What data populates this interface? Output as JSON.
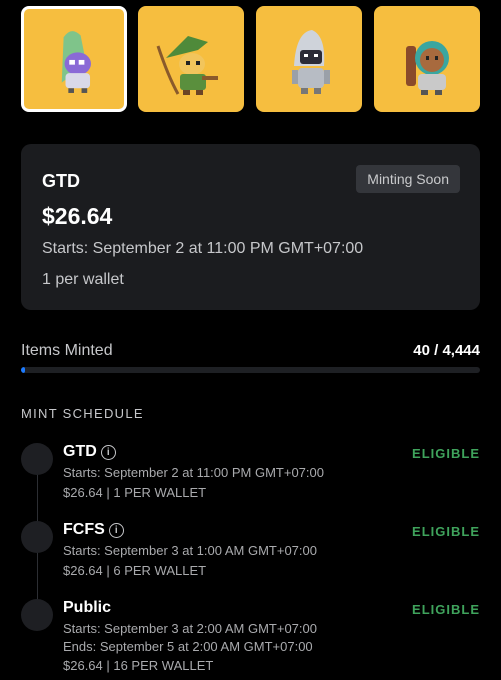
{
  "thumbnails": [
    {
      "name": "alien-character",
      "selected": true
    },
    {
      "name": "archer-character",
      "selected": false
    },
    {
      "name": "robot-character",
      "selected": false
    },
    {
      "name": "astronaut-character",
      "selected": false
    }
  ],
  "colors": {
    "thumbnail_bg": "#f6be3f",
    "eligible": "#3fa35c",
    "progress": "#1c7bff",
    "card_bg": "#1b1c1f"
  },
  "current_phase": {
    "title": "GTD",
    "badge": "Minting Soon",
    "price": "$26.64",
    "starts": "Starts: September 2 at 11:00 PM GMT+07:00",
    "limit": "1 per wallet"
  },
  "minted": {
    "label": "Items Minted",
    "count": "40 / 4,444",
    "progress_fraction": 0.009
  },
  "schedule": {
    "heading": "MINT SCHEDULE",
    "phases": [
      {
        "title": "GTD",
        "status": "ELIGIBLE",
        "starts": "Starts: September 2 at 11:00 PM GMT+07:00",
        "price_limit": "$26.64 | 1 PER WALLET"
      },
      {
        "title": "FCFS",
        "status": "ELIGIBLE",
        "starts": "Starts: September 3 at 1:00 AM GMT+07:00",
        "price_limit": "$26.64 | 6 PER WALLET"
      },
      {
        "title": "Public",
        "status": "ELIGIBLE",
        "starts": "Starts: September 3 at 2:00 AM GMT+07:00",
        "ends": "Ends: September 5 at 2:00 AM GMT+07:00",
        "price_limit": "$26.64 | 16 PER WALLET"
      }
    ]
  }
}
